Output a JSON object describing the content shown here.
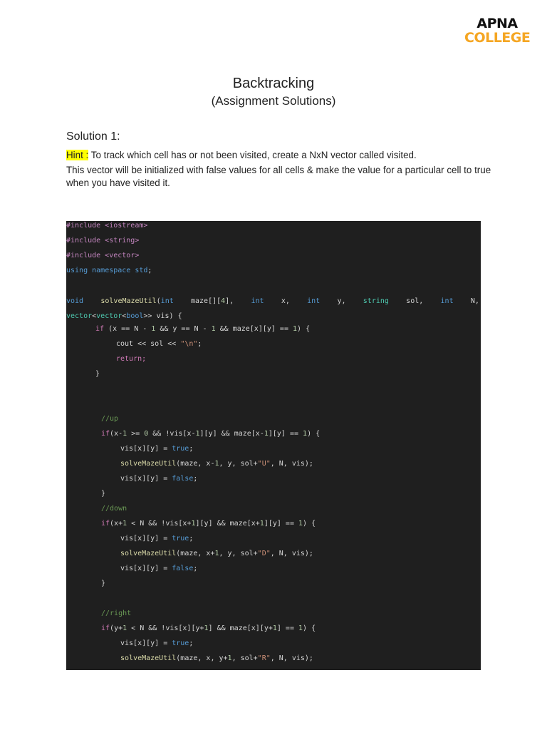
{
  "logo": {
    "top": "APNA",
    "bottom": "COLLEGE"
  },
  "document": {
    "title": "Backtracking",
    "subtitle": "(Assignment Solutions)",
    "solution_heading": "Solution 1:",
    "hint_label": "Hint :",
    "hint_text": " To track which cell has or not been visited, create a NxN vector called visited.",
    "description": "This vector will be initialized with false values for all cells & make the value for a particular cell to true when you have visited it."
  },
  "code": {
    "language": "cpp",
    "lines": [
      "#include <iostream>",
      "#include <string>",
      "#include <vector>",
      "using namespace std;",
      "",
      "void solveMazeUtil(int maze[][4], int x, int y, string sol, int N,",
      "vector<vector<bool>> vis) {",
      "if (x == N - 1 && y == N - 1 && maze[x][y] == 1) {",
      "cout << sol << \"\\n\";",
      "return;",
      "}",
      "",
      "",
      "//up",
      "if(x-1 >= 0 && !vis[x-1][y] && maze[x-1][y] == 1) {",
      "vis[x][y] = true;",
      "solveMazeUtil(maze, x-1, y, sol+\"U\", N, vis);",
      "vis[x][y] = false;",
      "}",
      "//down",
      "if(x+1 < N && !vis[x+1][y] && maze[x+1][y] == 1) {",
      "vis[x][y] = true;",
      "solveMazeUtil(maze, x+1, y, sol+\"D\", N, vis);",
      "vis[x][y] = false;",
      "}",
      "",
      "//right",
      "if(y+1 < N && !vis[x][y+1] && maze[x][y+1] == 1) {",
      "vis[x][y] = true;",
      "solveMazeUtil(maze, x, y+1, sol+\"R\", N, vis);"
    ]
  }
}
